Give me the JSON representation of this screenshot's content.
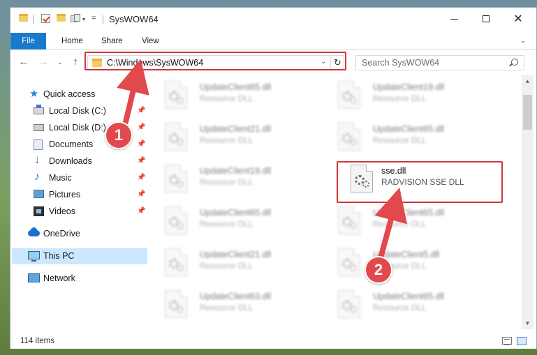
{
  "window": {
    "title": "SysWOW64",
    "controls": {
      "minimize": "",
      "maximize": "",
      "close": "✕"
    }
  },
  "ribbon": {
    "tabs": [
      {
        "label": "File"
      },
      {
        "label": "Home"
      },
      {
        "label": "Share"
      },
      {
        "label": "View"
      }
    ]
  },
  "address": {
    "path": "C:\\Windows\\SysWOW64",
    "search_placeholder": "Search SysWOW64"
  },
  "sidebar": {
    "items": [
      {
        "label": "Quick access",
        "icon": "star-icon"
      },
      {
        "label": "Local Disk (C:)",
        "icon": "local-disk-icon",
        "pinned": true
      },
      {
        "label": "Local Disk (D:)",
        "icon": "local-disk-icon",
        "pinned": true
      },
      {
        "label": "Documents",
        "icon": "documents-icon",
        "pinned": true
      },
      {
        "label": "Downloads",
        "icon": "downloads-icon",
        "pinned": true
      },
      {
        "label": "Music",
        "icon": "music-icon",
        "pinned": true
      },
      {
        "label": "Pictures",
        "icon": "pictures-icon",
        "pinned": true
      },
      {
        "label": "Videos",
        "icon": "videos-icon",
        "pinned": true
      },
      {
        "label": "OneDrive",
        "icon": "onedrive-icon"
      },
      {
        "label": "This PC",
        "icon": "this-pc-icon",
        "selected": true
      },
      {
        "label": "Network",
        "icon": "network-icon"
      }
    ]
  },
  "files": {
    "left_column": [
      {
        "name": "UpdateClient65.dll",
        "desc": "Resource DLL"
      },
      {
        "name": "UpdateClient21.dll",
        "desc": "Resource DLL"
      },
      {
        "name": "UpdateClient19.dll",
        "desc": "Resource DLL"
      },
      {
        "name": "UpdateClient65.dll",
        "desc": "Resource DLL"
      },
      {
        "name": "UpdateClient21.dll",
        "desc": "Resource DLL"
      },
      {
        "name": "UpdateClient63.dll",
        "desc": "Resource DLL"
      }
    ],
    "right_column": [
      {
        "name": "UpdateClient19.dll",
        "desc": "Resource DLL"
      },
      {
        "name": "UpdateClient65.dll",
        "desc": "Resource DLL"
      },
      {
        "name": "sse.dll",
        "desc": "RADVISION SSE DLL",
        "highlighted": true
      },
      {
        "name": "UpdateClient65.dll",
        "desc": "Resource DLL"
      },
      {
        "name": "UpdateClient5.dll",
        "desc": "Resource DLL"
      },
      {
        "name": "UpdateClient65.dll",
        "desc": "Resource DLL"
      }
    ]
  },
  "status": {
    "item_count": "114 items"
  },
  "annotations": {
    "step1": "1",
    "step2": "2",
    "color": "#e2494d"
  }
}
